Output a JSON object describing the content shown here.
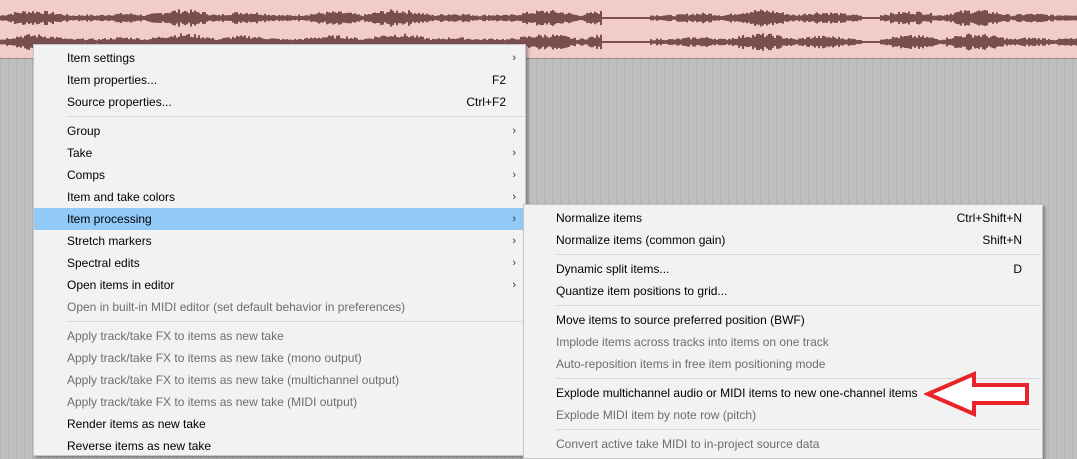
{
  "main_menu": {
    "items": [
      {
        "label": "Item settings",
        "shortcut": "",
        "submenu": true,
        "disabled": false
      },
      {
        "label": "Item properties...",
        "shortcut": "F2",
        "submenu": false,
        "disabled": false
      },
      {
        "label": "Source properties...",
        "shortcut": "Ctrl+F2",
        "submenu": false,
        "disabled": false
      },
      {
        "separator": true
      },
      {
        "label": "Group",
        "shortcut": "",
        "submenu": true,
        "disabled": false
      },
      {
        "label": "Take",
        "shortcut": "",
        "submenu": true,
        "disabled": false
      },
      {
        "label": "Comps",
        "shortcut": "",
        "submenu": true,
        "disabled": false
      },
      {
        "label": "Item and take colors",
        "shortcut": "",
        "submenu": true,
        "disabled": false
      },
      {
        "label": "Item processing",
        "shortcut": "",
        "submenu": true,
        "disabled": false,
        "highlighted": true
      },
      {
        "label": "Stretch markers",
        "shortcut": "",
        "submenu": true,
        "disabled": false
      },
      {
        "label": "Spectral edits",
        "shortcut": "",
        "submenu": true,
        "disabled": false
      },
      {
        "label": "Open items in editor",
        "shortcut": "",
        "submenu": true,
        "disabled": false
      },
      {
        "label": "Open in built-in MIDI editor (set default behavior in preferences)",
        "shortcut": "",
        "submenu": false,
        "disabled": true
      },
      {
        "separator": true
      },
      {
        "label": "Apply track/take FX to items as new take",
        "shortcut": "",
        "submenu": false,
        "disabled": true
      },
      {
        "label": "Apply track/take FX to items as new take (mono output)",
        "shortcut": "",
        "submenu": false,
        "disabled": true
      },
      {
        "label": "Apply track/take FX to items as new take (multichannel output)",
        "shortcut": "",
        "submenu": false,
        "disabled": true
      },
      {
        "label": "Apply track/take FX to items as new take (MIDI output)",
        "shortcut": "",
        "submenu": false,
        "disabled": true
      },
      {
        "label": "Render items as new take",
        "shortcut": "",
        "submenu": false,
        "disabled": false
      },
      {
        "label": "Reverse items as new take",
        "shortcut": "",
        "submenu": false,
        "disabled": false
      }
    ]
  },
  "sub_menu": {
    "items": [
      {
        "label": "Normalize items",
        "shortcut": "Ctrl+Shift+N",
        "disabled": false
      },
      {
        "label": "Normalize items (common gain)",
        "shortcut": "Shift+N",
        "disabled": false
      },
      {
        "separator": true
      },
      {
        "label": "Dynamic split items...",
        "shortcut": "D",
        "disabled": false
      },
      {
        "label": "Quantize item positions to grid...",
        "shortcut": "",
        "disabled": false
      },
      {
        "separator": true
      },
      {
        "label": "Move items to source preferred position (BWF)",
        "shortcut": "",
        "disabled": false
      },
      {
        "label": "Implode items across tracks into items on one track",
        "shortcut": "",
        "disabled": true
      },
      {
        "label": "Auto-reposition items in free item positioning mode",
        "shortcut": "",
        "disabled": true
      },
      {
        "separator": true
      },
      {
        "label": "Explode multichannel audio or MIDI items to new one-channel items",
        "shortcut": "",
        "disabled": false
      },
      {
        "label": "Explode MIDI item by note row (pitch)",
        "shortcut": "",
        "disabled": true
      },
      {
        "separator": true
      },
      {
        "label": "Convert active take MIDI to in-project source data",
        "shortcut": "",
        "disabled": true
      }
    ]
  },
  "icons": {
    "submenu_arrow": "chevron-right-icon",
    "annotation": "red-arrow-icon"
  },
  "colors": {
    "highlight": "#91c9f7",
    "waveform_bg": "#f2cbcb",
    "waveform": "#7a4e4e",
    "annotation": "#e8242a",
    "menu_bg": "#f2f2f2",
    "disabled_text": "#6d6d6d"
  }
}
